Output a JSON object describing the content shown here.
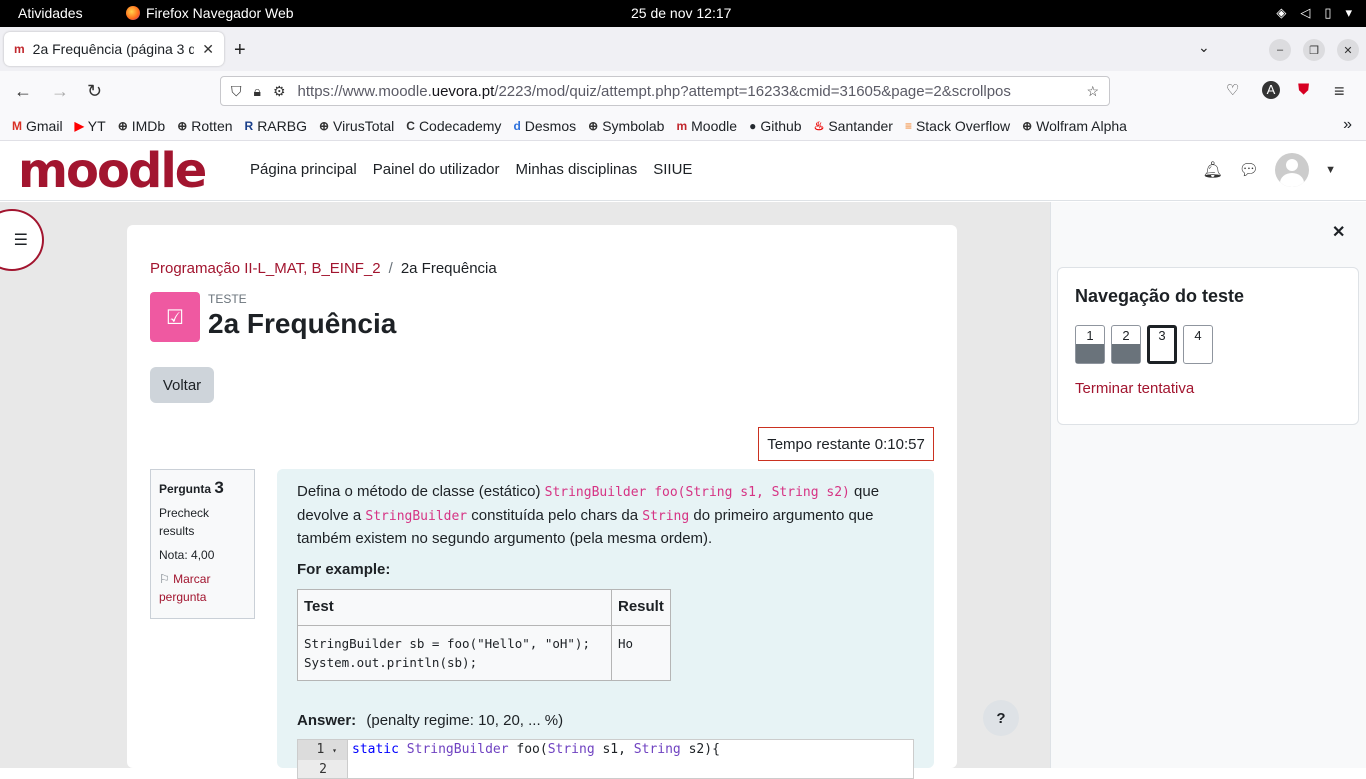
{
  "gnome": {
    "activities": "Atividades",
    "app_name": "Firefox Navegador Web",
    "clock": "25 de nov  12:17"
  },
  "browser": {
    "tab_title": "2a Frequência (página 3 d",
    "url_prefix": "https://www.moodle.",
    "url_domain": "uevora.pt",
    "url_rest": "/2223/mod/quiz/attempt.php?attempt=16233&cmid=31605&page=2&scrollpos",
    "bookmarks": [
      {
        "icon": "gmail-icon",
        "glyph": "M",
        "label": "Gmail",
        "color": "#d93025"
      },
      {
        "icon": "youtube-icon",
        "glyph": "▶",
        "label": "YT",
        "color": "#ff0000"
      },
      {
        "icon": "globe-icon",
        "glyph": "⊕",
        "label": "IMDb",
        "color": "#333333"
      },
      {
        "icon": "globe-icon",
        "glyph": "⊕",
        "label": "Rotten",
        "color": "#333333"
      },
      {
        "icon": "rarbg-icon",
        "glyph": "R",
        "label": "RARBG",
        "color": "#1a3f8a"
      },
      {
        "icon": "globe-icon",
        "glyph": "⊕",
        "label": "VirusTotal",
        "color": "#333333"
      },
      {
        "icon": "codecademy-icon",
        "glyph": "C",
        "label": "Codecademy",
        "color": "#333333"
      },
      {
        "icon": "desmos-icon",
        "glyph": "d",
        "label": "Desmos",
        "color": "#2f72dc"
      },
      {
        "icon": "globe-icon",
        "glyph": "⊕",
        "label": "Symbolab",
        "color": "#333333"
      },
      {
        "icon": "moodle-icon",
        "glyph": "m",
        "label": "Moodle",
        "color": "#c1272d"
      },
      {
        "icon": "github-icon",
        "glyph": "●",
        "label": "Github",
        "color": "#24292f"
      },
      {
        "icon": "santander-icon",
        "glyph": "♨",
        "label": "Santander",
        "color": "#ec0000"
      },
      {
        "icon": "stackoverflow-icon",
        "glyph": "≡",
        "label": "Stack Overflow",
        "color": "#f48024"
      },
      {
        "icon": "globe-icon",
        "glyph": "⊕",
        "label": "Wolfram Alpha",
        "color": "#333333"
      }
    ]
  },
  "moodle": {
    "logo": "moodle",
    "nav": [
      "Página principal",
      "Painel do utilizador",
      "Minhas disciplinas",
      "SIIUE"
    ]
  },
  "page": {
    "breadcrumb": {
      "course": "Programação II-L_MAT, B_EINF_2",
      "separator": "/",
      "current": "2a Frequência"
    },
    "quiz_label": "TESTE",
    "quiz_title": "2a Frequência",
    "back_button": "Voltar",
    "timer": "Tempo restante 0:10:57"
  },
  "question": {
    "label": "Pergunta",
    "number": "3",
    "status": "Precheck results",
    "grade": "Nota: 4,00",
    "flag": "Marcar pergunta",
    "text_1": "Defina o método de classe (estático) ",
    "code_1": "StringBuilder foo(String s1, String s2)",
    "text_2": " que devolve a ",
    "code_2": "StringBuilder",
    "text_3": " constituída pelo chars da ",
    "code_3": "String",
    "text_4": " do primeiro argumento que também existem no segundo argumento (pela mesma ordem).",
    "example_heading": "For example:",
    "table_headers": [
      "Test",
      "Result"
    ],
    "table_row": {
      "test": "StringBuilder sb = foo(\"Hello\", \"oH\");\nSystem.out.println(sb);",
      "result": "Ho"
    },
    "answer_label": "Answer:",
    "penalty": "(penalty regime: 10, 20, ... %)",
    "editor_lines": [
      "1",
      "2"
    ],
    "code_kw": "static",
    "code_t1": "StringBuilder",
    "code_fn": " foo(",
    "code_t2": "String",
    "code_a1": " s1, ",
    "code_t3": "String",
    "code_a2": " s2){"
  },
  "drawer": {
    "title": "Navegação do teste",
    "buttons": [
      "1",
      "2",
      "3",
      "4"
    ],
    "finish": "Terminar tentativa"
  },
  "help": "?"
}
